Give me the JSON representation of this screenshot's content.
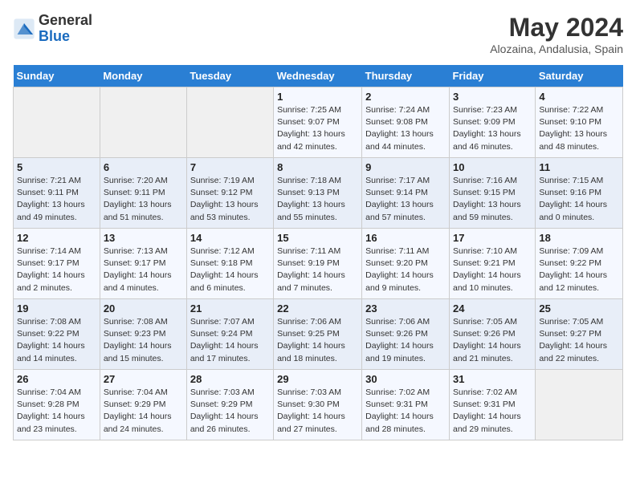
{
  "header": {
    "logo_general": "General",
    "logo_blue": "Blue",
    "month_title": "May 2024",
    "location": "Alozaina, Andalusia, Spain"
  },
  "weekdays": [
    "Sunday",
    "Monday",
    "Tuesday",
    "Wednesday",
    "Thursday",
    "Friday",
    "Saturday"
  ],
  "weeks": [
    [
      {
        "day": "",
        "info": ""
      },
      {
        "day": "",
        "info": ""
      },
      {
        "day": "",
        "info": ""
      },
      {
        "day": "1",
        "info": "Sunrise: 7:25 AM\nSunset: 9:07 PM\nDaylight: 13 hours\nand 42 minutes."
      },
      {
        "day": "2",
        "info": "Sunrise: 7:24 AM\nSunset: 9:08 PM\nDaylight: 13 hours\nand 44 minutes."
      },
      {
        "day": "3",
        "info": "Sunrise: 7:23 AM\nSunset: 9:09 PM\nDaylight: 13 hours\nand 46 minutes."
      },
      {
        "day": "4",
        "info": "Sunrise: 7:22 AM\nSunset: 9:10 PM\nDaylight: 13 hours\nand 48 minutes."
      }
    ],
    [
      {
        "day": "5",
        "info": "Sunrise: 7:21 AM\nSunset: 9:11 PM\nDaylight: 13 hours\nand 49 minutes."
      },
      {
        "day": "6",
        "info": "Sunrise: 7:20 AM\nSunset: 9:11 PM\nDaylight: 13 hours\nand 51 minutes."
      },
      {
        "day": "7",
        "info": "Sunrise: 7:19 AM\nSunset: 9:12 PM\nDaylight: 13 hours\nand 53 minutes."
      },
      {
        "day": "8",
        "info": "Sunrise: 7:18 AM\nSunset: 9:13 PM\nDaylight: 13 hours\nand 55 minutes."
      },
      {
        "day": "9",
        "info": "Sunrise: 7:17 AM\nSunset: 9:14 PM\nDaylight: 13 hours\nand 57 minutes."
      },
      {
        "day": "10",
        "info": "Sunrise: 7:16 AM\nSunset: 9:15 PM\nDaylight: 13 hours\nand 59 minutes."
      },
      {
        "day": "11",
        "info": "Sunrise: 7:15 AM\nSunset: 9:16 PM\nDaylight: 14 hours\nand 0 minutes."
      }
    ],
    [
      {
        "day": "12",
        "info": "Sunrise: 7:14 AM\nSunset: 9:17 PM\nDaylight: 14 hours\nand 2 minutes."
      },
      {
        "day": "13",
        "info": "Sunrise: 7:13 AM\nSunset: 9:17 PM\nDaylight: 14 hours\nand 4 minutes."
      },
      {
        "day": "14",
        "info": "Sunrise: 7:12 AM\nSunset: 9:18 PM\nDaylight: 14 hours\nand 6 minutes."
      },
      {
        "day": "15",
        "info": "Sunrise: 7:11 AM\nSunset: 9:19 PM\nDaylight: 14 hours\nand 7 minutes."
      },
      {
        "day": "16",
        "info": "Sunrise: 7:11 AM\nSunset: 9:20 PM\nDaylight: 14 hours\nand 9 minutes."
      },
      {
        "day": "17",
        "info": "Sunrise: 7:10 AM\nSunset: 9:21 PM\nDaylight: 14 hours\nand 10 minutes."
      },
      {
        "day": "18",
        "info": "Sunrise: 7:09 AM\nSunset: 9:22 PM\nDaylight: 14 hours\nand 12 minutes."
      }
    ],
    [
      {
        "day": "19",
        "info": "Sunrise: 7:08 AM\nSunset: 9:22 PM\nDaylight: 14 hours\nand 14 minutes."
      },
      {
        "day": "20",
        "info": "Sunrise: 7:08 AM\nSunset: 9:23 PM\nDaylight: 14 hours\nand 15 minutes."
      },
      {
        "day": "21",
        "info": "Sunrise: 7:07 AM\nSunset: 9:24 PM\nDaylight: 14 hours\nand 17 minutes."
      },
      {
        "day": "22",
        "info": "Sunrise: 7:06 AM\nSunset: 9:25 PM\nDaylight: 14 hours\nand 18 minutes."
      },
      {
        "day": "23",
        "info": "Sunrise: 7:06 AM\nSunset: 9:26 PM\nDaylight: 14 hours\nand 19 minutes."
      },
      {
        "day": "24",
        "info": "Sunrise: 7:05 AM\nSunset: 9:26 PM\nDaylight: 14 hours\nand 21 minutes."
      },
      {
        "day": "25",
        "info": "Sunrise: 7:05 AM\nSunset: 9:27 PM\nDaylight: 14 hours\nand 22 minutes."
      }
    ],
    [
      {
        "day": "26",
        "info": "Sunrise: 7:04 AM\nSunset: 9:28 PM\nDaylight: 14 hours\nand 23 minutes."
      },
      {
        "day": "27",
        "info": "Sunrise: 7:04 AM\nSunset: 9:29 PM\nDaylight: 14 hours\nand 24 minutes."
      },
      {
        "day": "28",
        "info": "Sunrise: 7:03 AM\nSunset: 9:29 PM\nDaylight: 14 hours\nand 26 minutes."
      },
      {
        "day": "29",
        "info": "Sunrise: 7:03 AM\nSunset: 9:30 PM\nDaylight: 14 hours\nand 27 minutes."
      },
      {
        "day": "30",
        "info": "Sunrise: 7:02 AM\nSunset: 9:31 PM\nDaylight: 14 hours\nand 28 minutes."
      },
      {
        "day": "31",
        "info": "Sunrise: 7:02 AM\nSunset: 9:31 PM\nDaylight: 14 hours\nand 29 minutes."
      },
      {
        "day": "",
        "info": ""
      }
    ]
  ]
}
